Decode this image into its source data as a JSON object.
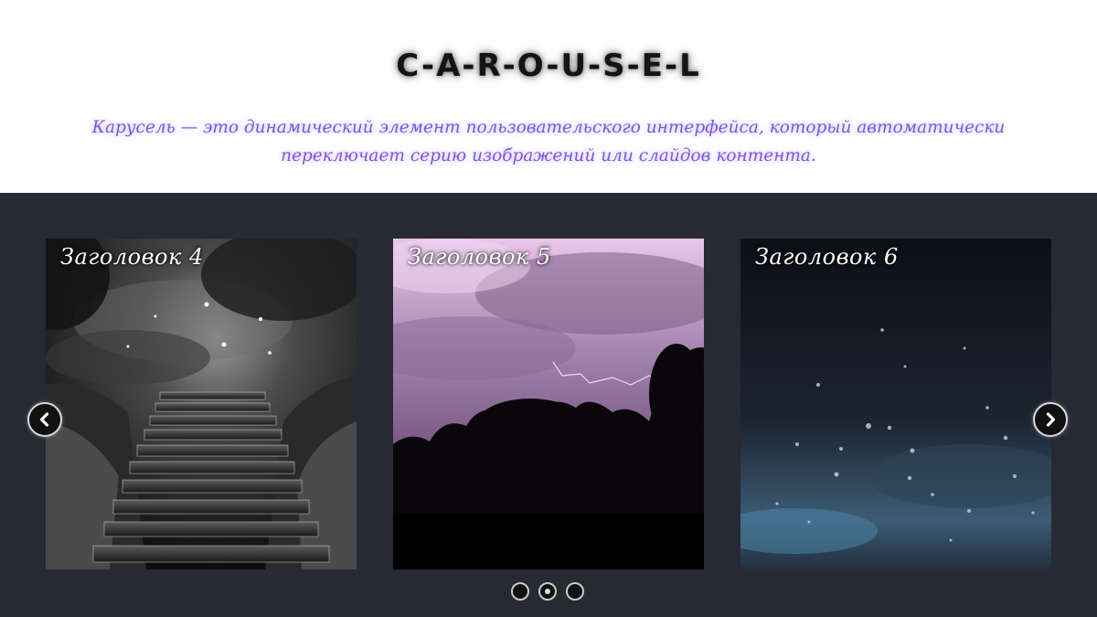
{
  "header": {
    "title": "C-A-R-O-U-S-E-L",
    "description": "Карусель — это динамический элемент пользовательского интерфейса, который автоматически переключает серию изображений или слайдов контента."
  },
  "carousel": {
    "slides": [
      {
        "title": "Заголовок 4",
        "image": "dark-stairs-stars-image"
      },
      {
        "title": "Заголовок 5",
        "image": "purple-lightning-trees-image"
      },
      {
        "title": "Заголовок 6",
        "image": "raindrops-night-sky-image"
      }
    ],
    "prev_icon": "chevron-left-icon",
    "next_icon": "chevron-right-icon",
    "pagination_count": 3,
    "active_page": 2
  },
  "colors": {
    "stage_background": "#272935",
    "description_text": "#7b55e6",
    "title_text": "#141414"
  }
}
